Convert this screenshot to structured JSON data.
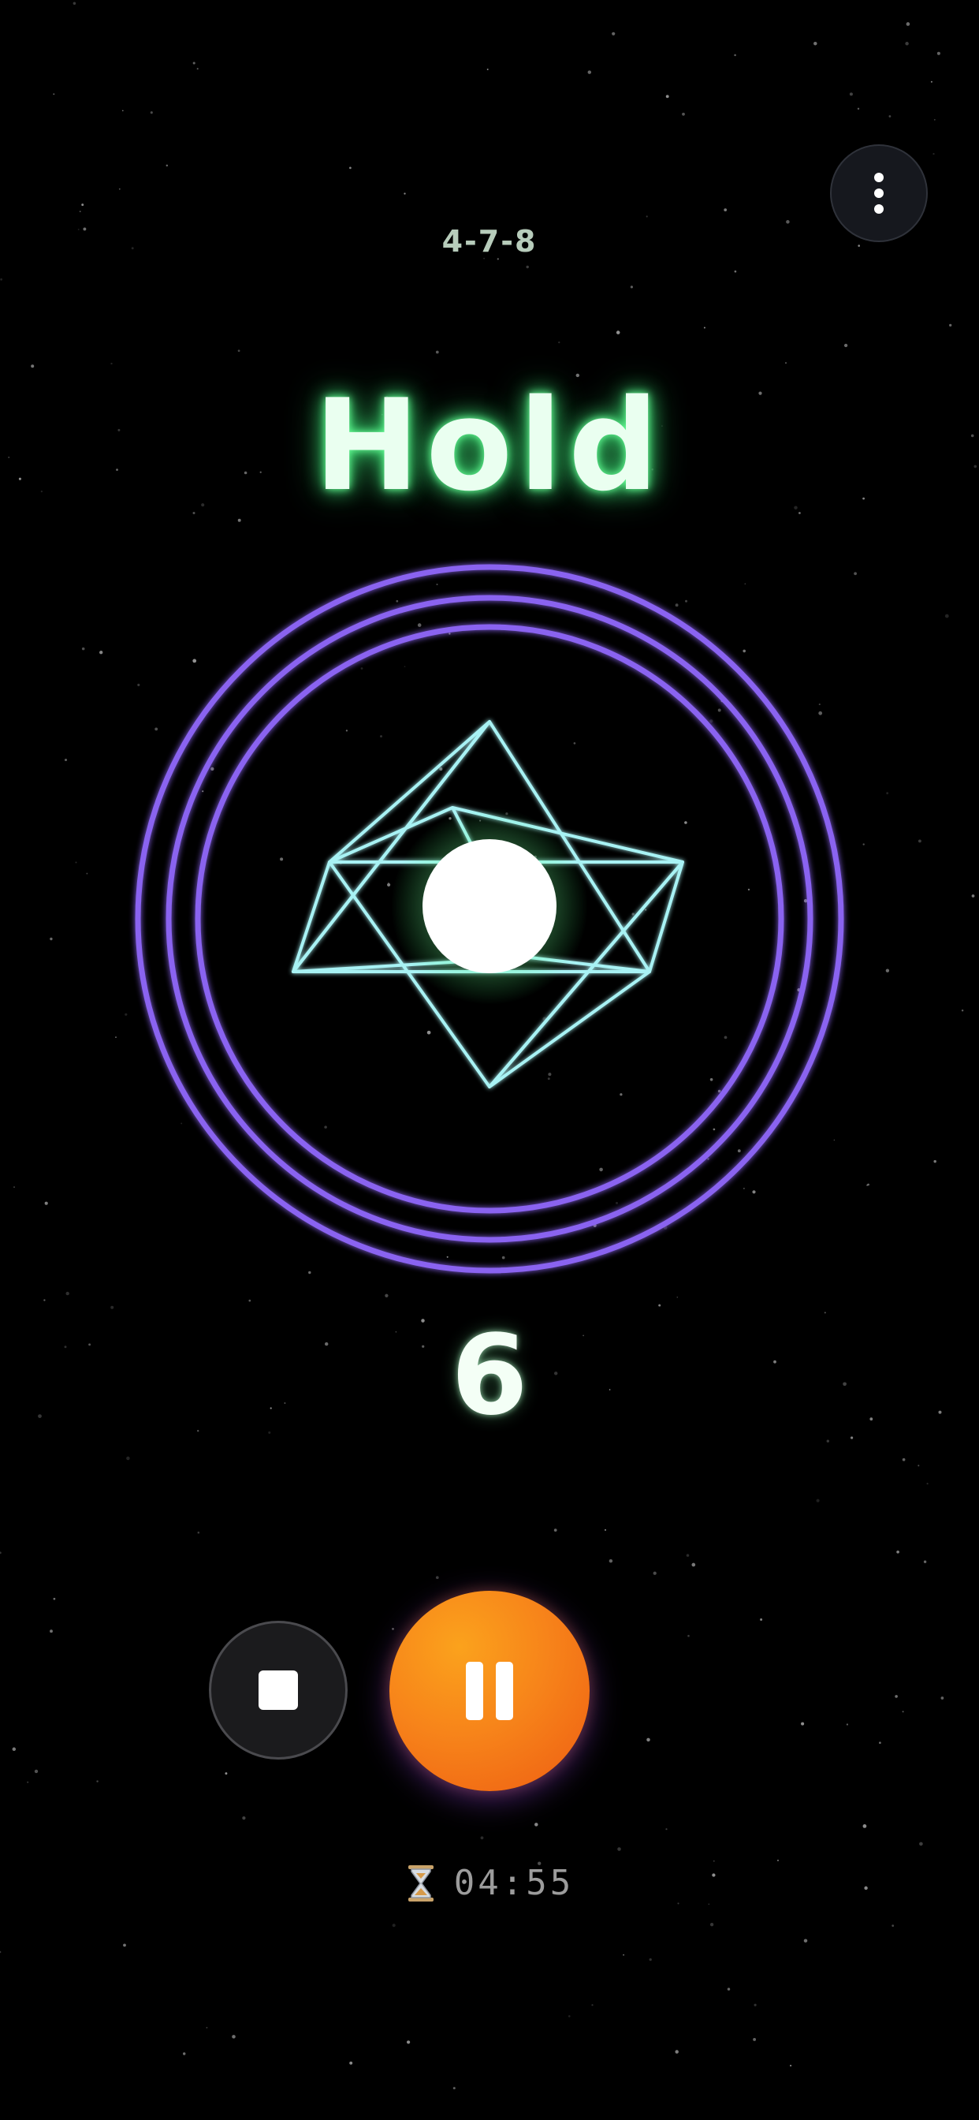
{
  "session": {
    "pattern": "4-7-8",
    "phase": "Hold",
    "count": "6",
    "time_remaining": "04:55"
  },
  "controls": {
    "menu_icon": "more-vertical-icon",
    "stop_icon": "stop-icon",
    "pause_icon": "pause-icon",
    "timer_icon": "hourglass-icon"
  },
  "colors": {
    "background": "#000000",
    "phase_glow": "#6dff9a",
    "ring": "#8a63f0",
    "star_lines": "#a8f2f4",
    "orb": "#ffffff",
    "pause_button": "#f7841a",
    "stop_button": "#1b1b1d",
    "timer_text": "#9c9c9c"
  }
}
